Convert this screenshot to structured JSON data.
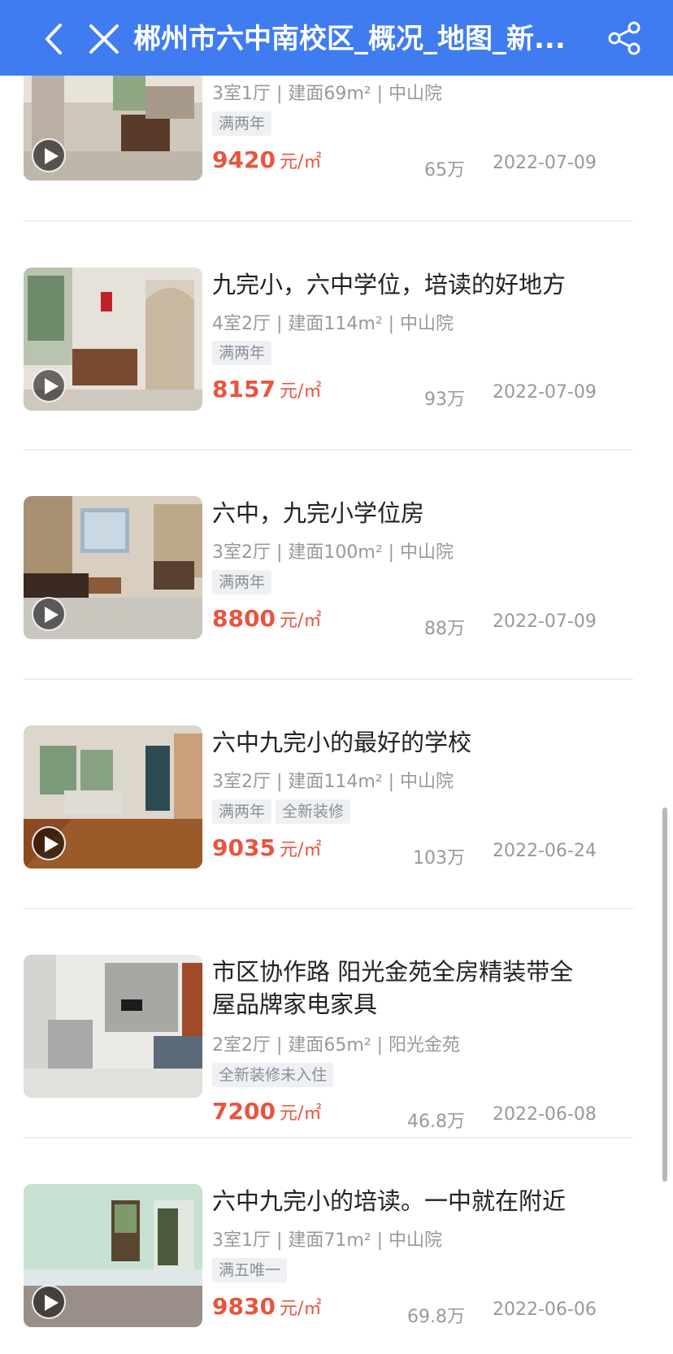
{
  "header": {
    "title": "郴州市六中南校区_概况_地图_新...",
    "back_icon": "chevron-left-icon",
    "close_icon": "close-icon",
    "share_icon": "share-icon",
    "bg_color": "#3f7cf0"
  },
  "accent_color": "#e9543f",
  "listings": [
    {
      "title": "",
      "meta": "3室1厅 | 建面69m² | 中山院",
      "tags": [
        "满两年"
      ],
      "price": "9420",
      "price_unit": "元/㎡",
      "total": "65万",
      "date": "2022-07-09",
      "has_video": true
    },
    {
      "title": "九完小，六中学位，培读的好地方",
      "meta": "4室2厅 | 建面114m² | 中山院",
      "tags": [
        "满两年"
      ],
      "price": "8157",
      "price_unit": "元/㎡",
      "total": "93万",
      "date": "2022-07-09",
      "has_video": true
    },
    {
      "title": "六中，九完小学位房",
      "meta": "3室2厅 | 建面100m² | 中山院",
      "tags": [
        "满两年"
      ],
      "price": "8800",
      "price_unit": "元/㎡",
      "total": "88万",
      "date": "2022-07-09",
      "has_video": true
    },
    {
      "title": "六中九完小的最好的学校",
      "meta": "3室2厅 | 建面114m² | 中山院",
      "tags": [
        "满两年",
        "全新装修"
      ],
      "price": "9035",
      "price_unit": "元/㎡",
      "total": "103万",
      "date": "2022-06-24",
      "has_video": true
    },
    {
      "title": "市区协作路 阳光金苑全房精装带全屋品牌家电家具",
      "meta": "2室2厅 | 建面65m² | 阳光金苑",
      "tags": [
        "全新装修未入住"
      ],
      "price": "7200",
      "price_unit": "元/㎡",
      "total": "46.8万",
      "date": "2022-06-08",
      "has_video": false
    },
    {
      "title": "六中九完小的培读。一中就在附近",
      "meta": "3室1厅 | 建面71m² | 中山院",
      "tags": [
        "满五唯一"
      ],
      "price": "9830",
      "price_unit": "元/㎡",
      "total": "69.8万",
      "date": "2022-06-06",
      "has_video": true
    }
  ]
}
